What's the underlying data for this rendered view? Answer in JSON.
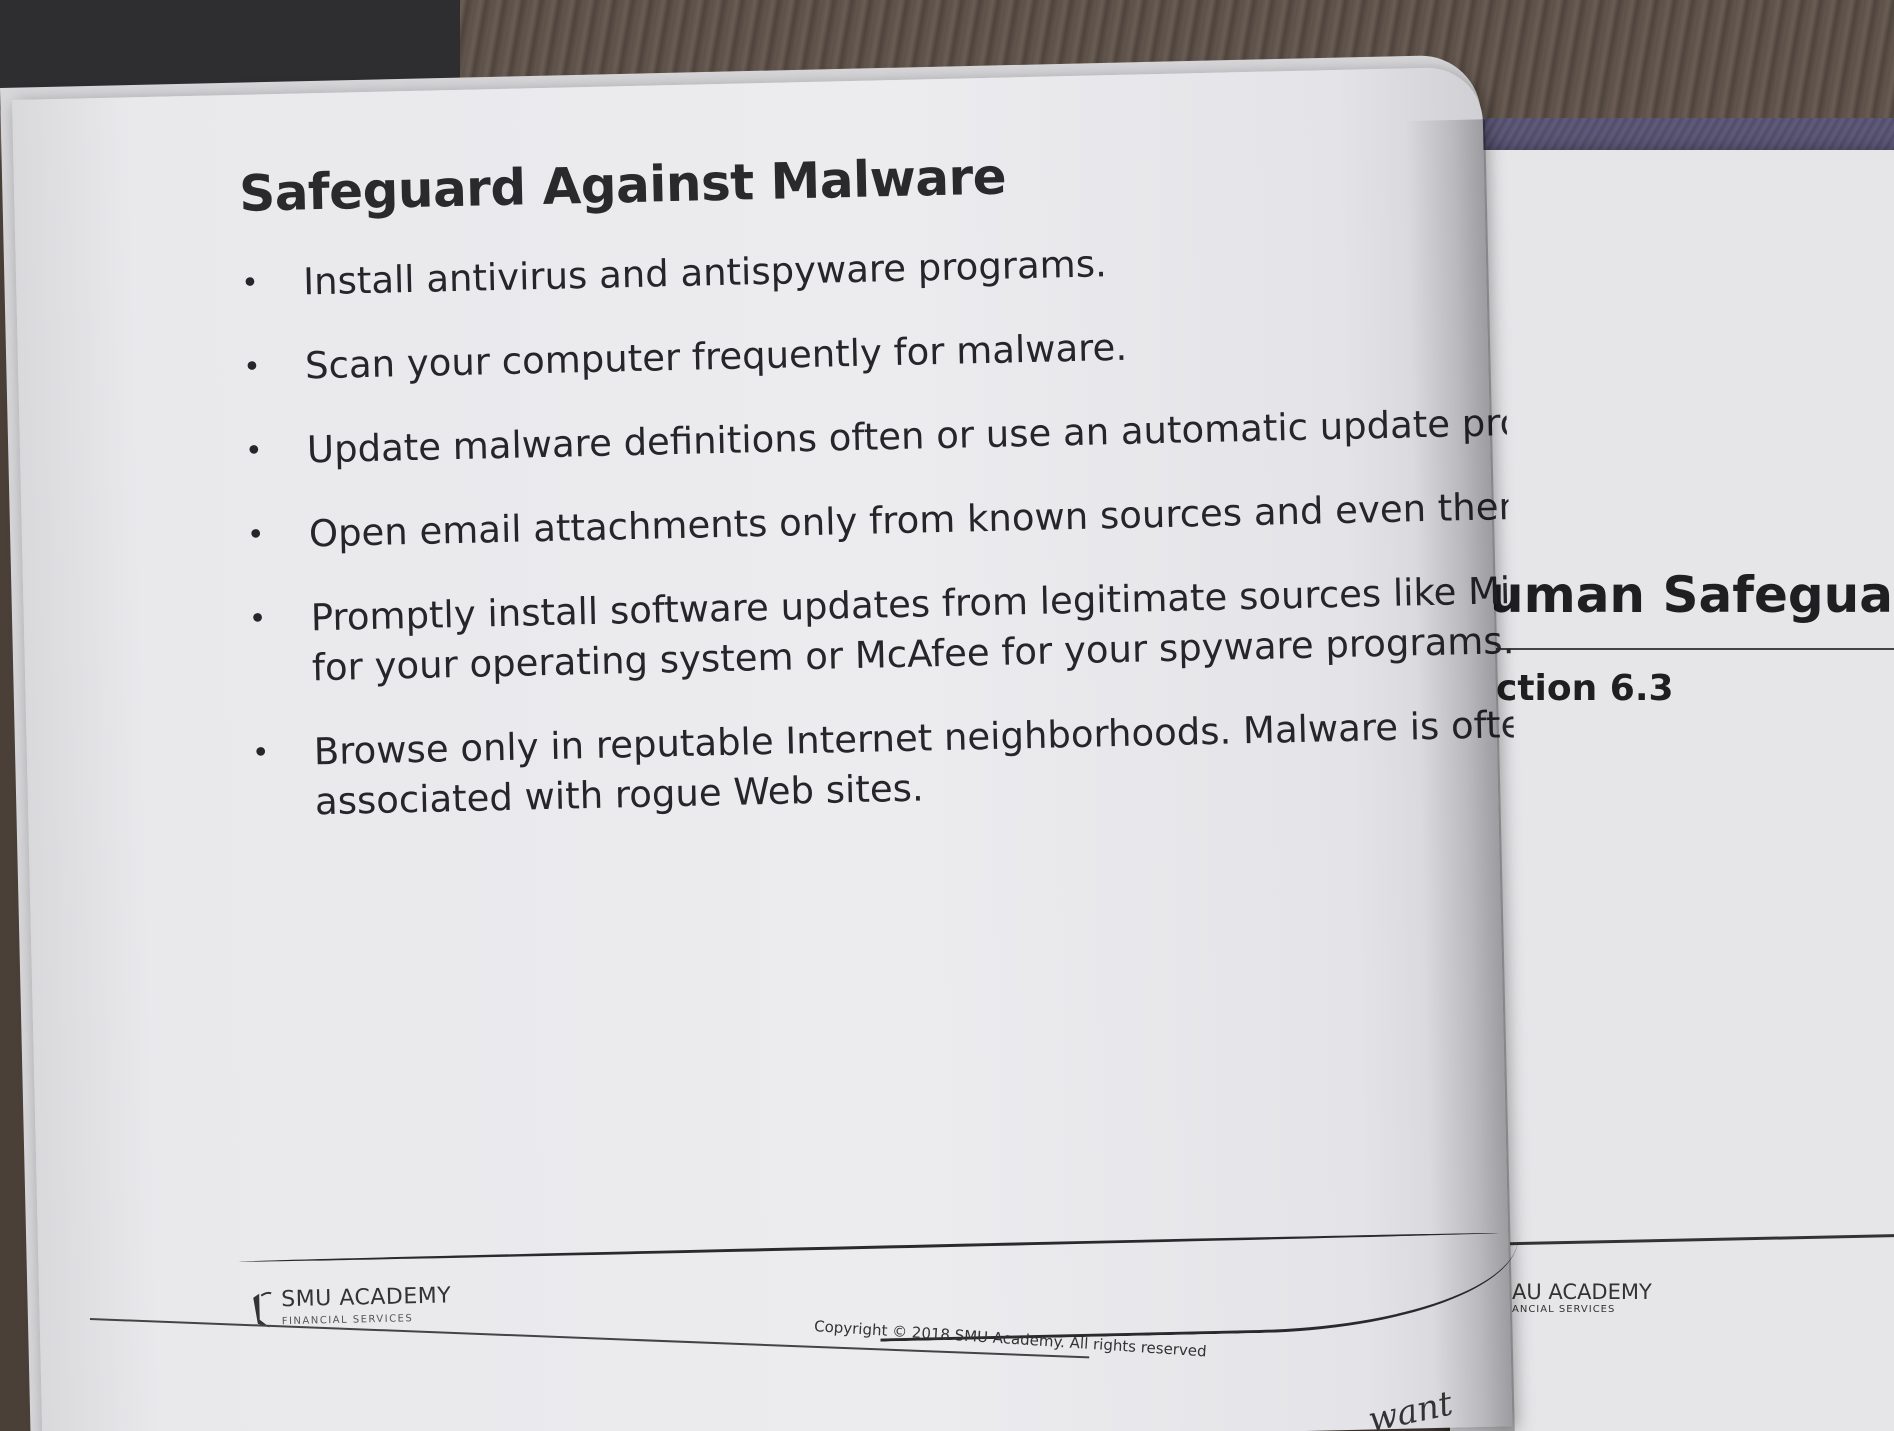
{
  "page": {
    "title": "Safeguard Against Malware",
    "bullets": [
      {
        "lines": [
          "Install antivirus and antispyware programs."
        ]
      },
      {
        "lines": [
          "Scan your computer frequently for malware."
        ]
      },
      {
        "lines": [
          "Update malware definitions often or use an automatic update pro"
        ]
      },
      {
        "lines": [
          "Open email attachments only from known sources and even then"
        ]
      },
      {
        "lines": [
          "Promptly install software updates from legitimate sources like Mi",
          "for your operating system or McAfee for your spyware programs."
        ]
      },
      {
        "lines": [
          "Browse only in reputable Internet neighborhoods. Malware is ofte",
          "associated with rogue Web sites."
        ]
      }
    ],
    "footer": {
      "logo_name": "SMU ACADEMY",
      "logo_sub": "FINANCIAL SERVICES",
      "copyright": "Copyright © 2018 SMU Academy. All rights reserved"
    }
  },
  "back_page": {
    "heading": "uman Safeguards",
    "section": "ction 6.3",
    "logo_name": "AU ACADEMY",
    "logo_sub": "ANCIAL SERVICES"
  },
  "handwriting": "want",
  "colors": {
    "paper": "#ececef",
    "text": "#26262a",
    "table": "#5c5048",
    "binder_stripe": "#56506e"
  }
}
